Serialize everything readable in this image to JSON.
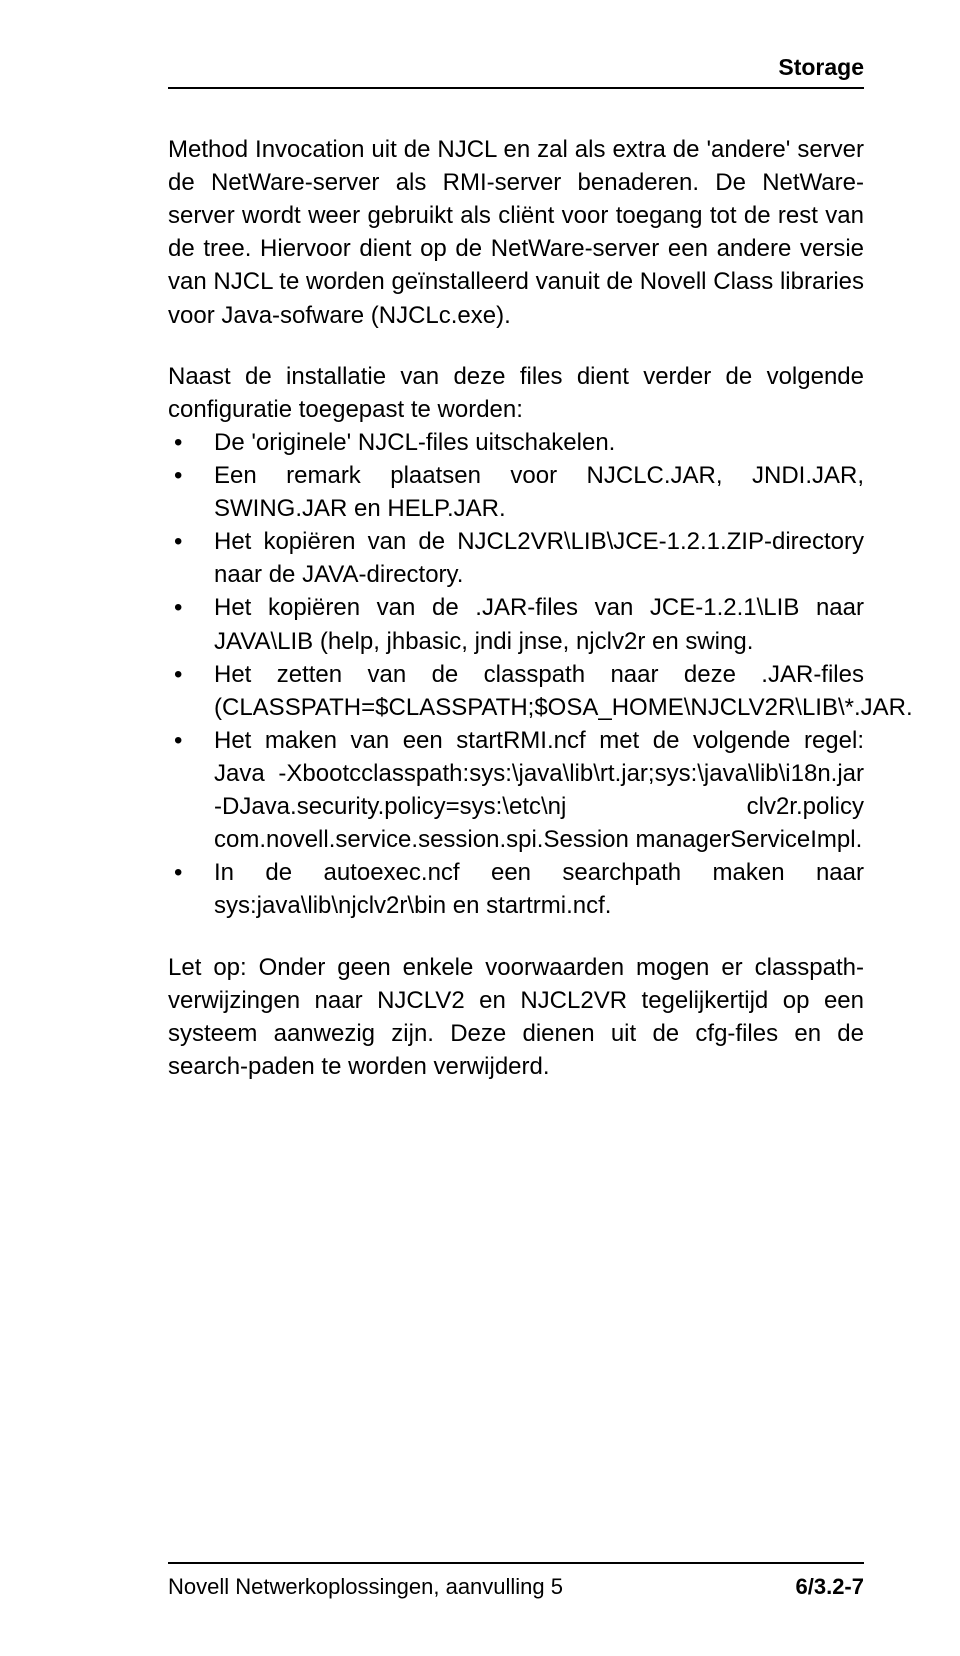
{
  "header": {
    "title": "Storage"
  },
  "content": {
    "para1": "Method Invocation uit de NJCL en zal als extra de 'andere' server de NetWare-server als RMI-server benaderen. De NetWare-server wordt weer gebruikt als cliënt voor toegang tot de rest van de tree. Hiervoor dient op de NetWare-server een andere versie van NJCL te worden geïnstalleerd vanuit de Novell Class libraries voor Java-sofware (NJCLc.exe).",
    "para2": "Naast de installatie van deze files dient verder de volgende configuratie toegepast te worden:",
    "bullets": [
      "De 'originele' NJCL-files uitschakelen.",
      "Een remark plaatsen voor NJCLC.JAR, JNDI.JAR, SWING.JAR en HELP.JAR.",
      "Het kopiëren van de NJCL2VR\\LIB\\JCE-1.2.1.ZIP-directory naar de JAVA-directory.",
      "Het kopiëren van de .JAR-files van JCE-1.2.1\\LIB naar JAVA\\LIB (help, jhbasic, jndi jnse, njclv2r en swing.",
      "Het zetten van de classpath naar deze .JAR-files (CLASSPATH=$CLASSPATH;$OSA_HOME\\NJCLV2R\\LIB\\*.JAR.",
      "Het maken van een startRMI.ncf met de volgende regel: Java -Xbootcclasspath:sys:\\java\\lib\\rt.jar;sys:\\java\\lib\\i18n.jar -DJava.security.policy=sys:\\etc\\nj clv2r.policy com.novell.service.session.spi.Session managerServiceImpl.",
      "In de autoexec.ncf een searchpath maken naar sys:java\\lib\\njclv2r\\bin en startrmi.ncf."
    ],
    "para3": "Let op: Onder geen enkele voorwaarden mogen er classpath-verwijzingen naar NJCLV2 en NJCL2VR tegelijkertijd op een systeem aanwezig zijn. Deze dienen uit de cfg-files en de search-paden te worden verwijderd."
  },
  "footer": {
    "left": "Novell Netwerkoplossingen, aanvulling 5",
    "right": "6/3.2-7"
  }
}
